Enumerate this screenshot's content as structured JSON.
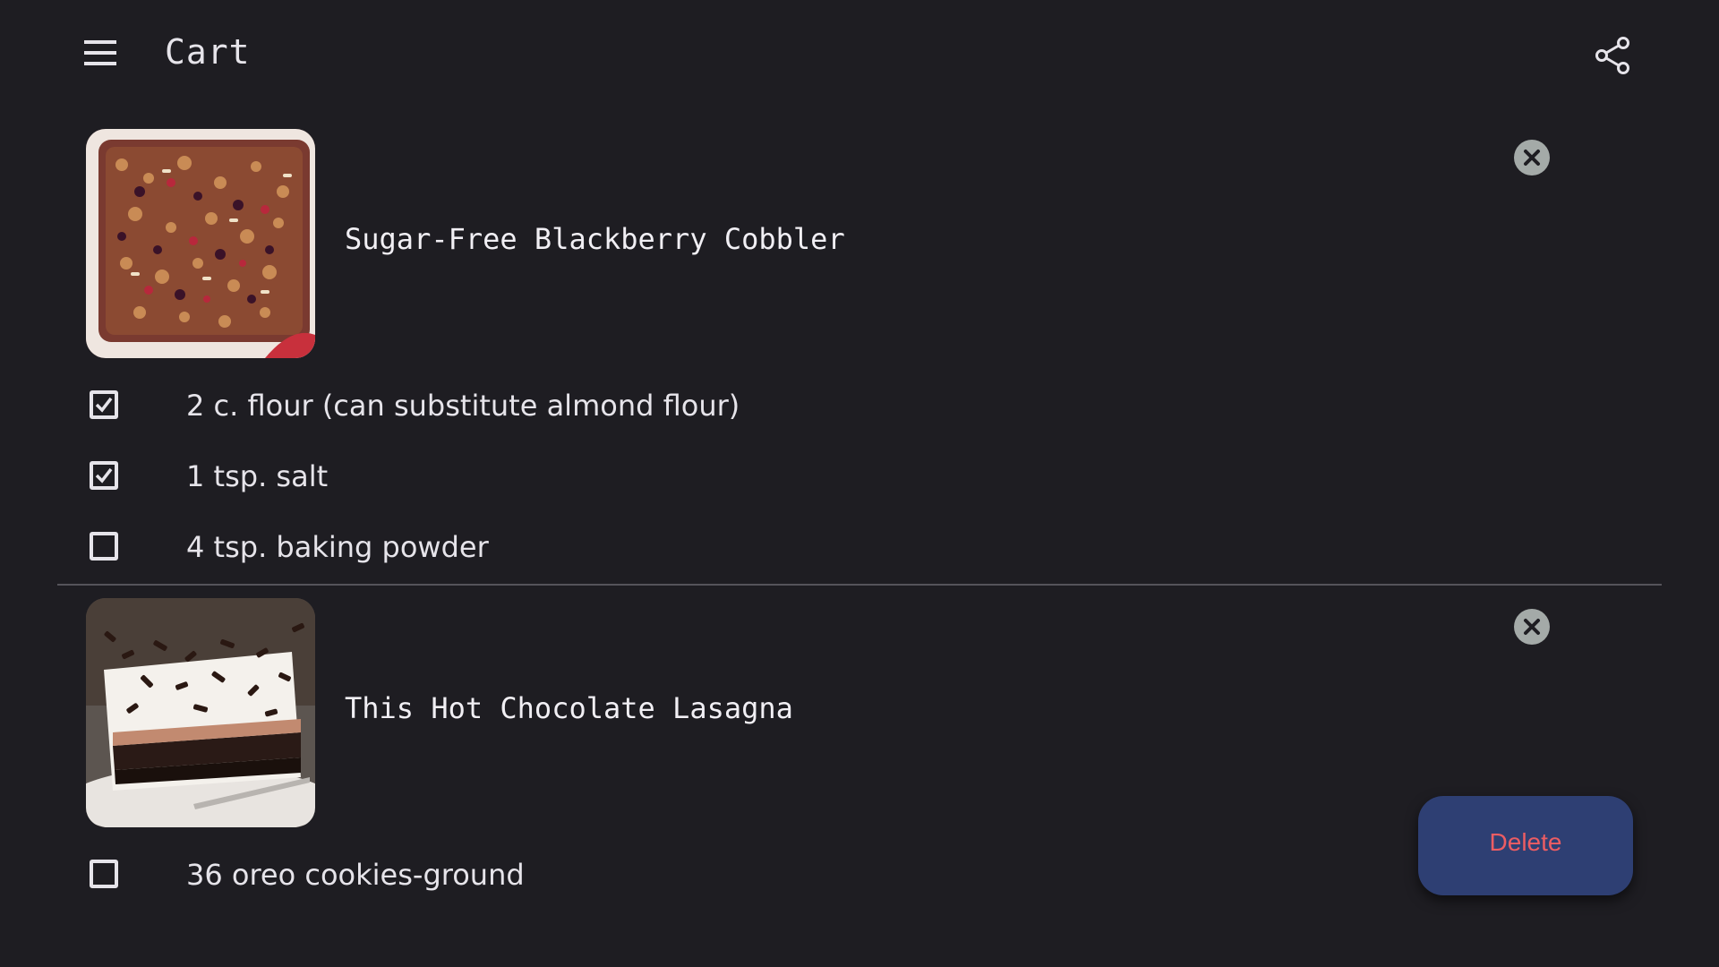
{
  "app_bar": {
    "title": "Cart",
    "menu_icon": "hamburger-menu-icon",
    "share_icon": "share-icon"
  },
  "recipes": [
    {
      "title": "Sugar-Free Blackberry Cobbler",
      "image": "blackberry-cobbler-photo",
      "remove_icon": "close-circle-icon",
      "ingredients": [
        {
          "text": "2 c. flour (can substitute almond flour)",
          "checked": true
        },
        {
          "text": "1 tsp. salt",
          "checked": true
        },
        {
          "text": "4 tsp. baking powder",
          "checked": false
        }
      ]
    },
    {
      "title": "This Hot Chocolate Lasagna",
      "image": "chocolate-lasagna-photo",
      "remove_icon": "close-circle-icon",
      "ingredients": [
        {
          "text": "36 oreo cookies-ground",
          "checked": false
        }
      ]
    }
  ],
  "fab": {
    "label": "Delete"
  },
  "colors": {
    "background": "#1e1d22",
    "text": "#e6e4ea",
    "fab_background": "#2e3f73",
    "fab_text": "#ec5d63",
    "remove_button": "#a4aaa8",
    "divider": "#55535a"
  }
}
